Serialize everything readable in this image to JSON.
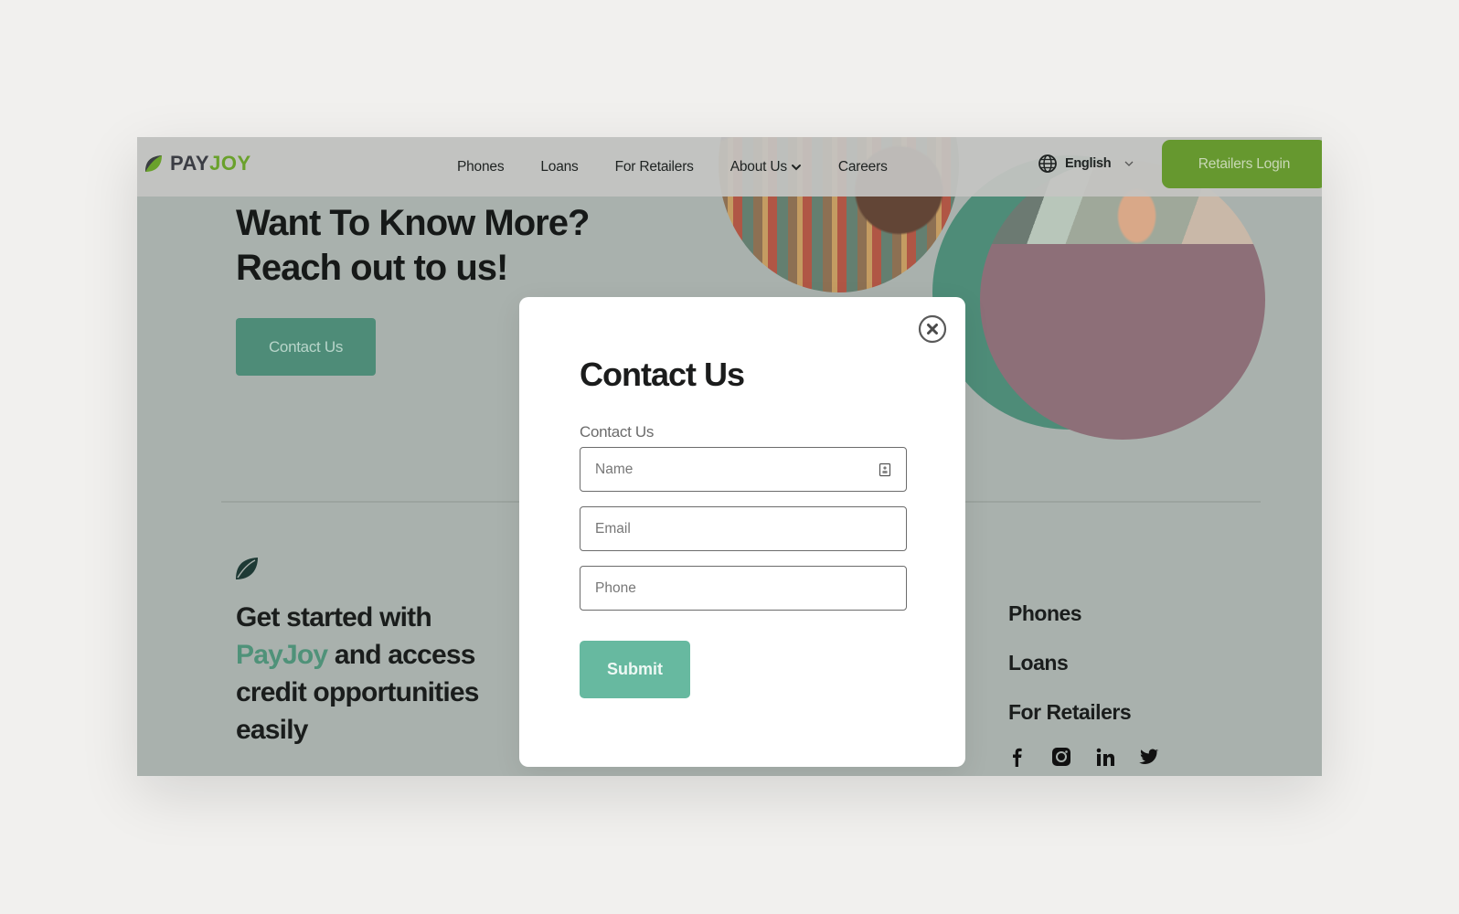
{
  "header": {
    "logo": {
      "pay": "PAY",
      "joy": "JOY"
    },
    "nav": [
      {
        "label": "Phones"
      },
      {
        "label": "Loans"
      },
      {
        "label": "For Retailers"
      },
      {
        "label": "About Us",
        "has_dropdown": true
      },
      {
        "label": "Careers"
      }
    ],
    "language": {
      "selected": "English",
      "icon": "globe-icon"
    },
    "login_button": "Retailers Login"
  },
  "hero": {
    "title_line1": "Want To Know More?",
    "title_line2": "Reach out to us!",
    "cta": "Contact Us"
  },
  "footer": {
    "tagline_pre": "Get started with",
    "tagline_brand": "PayJoy",
    "tagline_post": " and access credit opportunities easily",
    "links": [
      "Phones",
      "Loans",
      "For Retailers"
    ],
    "socials": [
      "facebook-icon",
      "instagram-icon",
      "linkedin-icon",
      "twitter-icon"
    ]
  },
  "modal": {
    "title": "Contact Us",
    "section_label": "Contact Us",
    "fields": {
      "name": {
        "placeholder": "Name",
        "value": ""
      },
      "email": {
        "placeholder": "Email",
        "value": ""
      },
      "phone": {
        "placeholder": "Phone",
        "value": ""
      }
    },
    "submit": "Submit"
  },
  "colors": {
    "brand_green": "#66982f",
    "brand_teal": "#4e8c78",
    "submit_teal": "#67b9a0",
    "overlay_bg": "#a9b1ad",
    "page_bg": "#f1f0ee"
  }
}
